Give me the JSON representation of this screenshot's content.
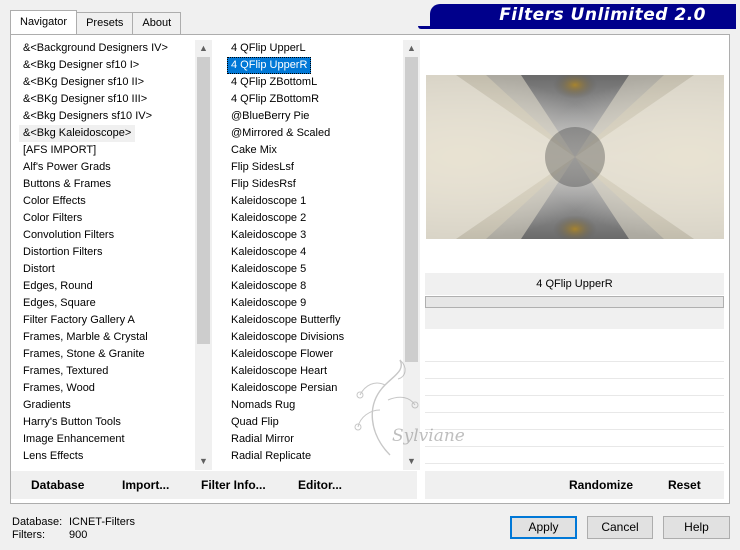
{
  "tabs": [
    "Navigator",
    "Presets",
    "About"
  ],
  "banner_title": "Filters Unlimited 2.0",
  "categories": [
    "&<Background Designers IV>",
    "&<Bkg Designer sf10 I>",
    "&<BKg Designer sf10 II>",
    "&<BKg Designer sf10 III>",
    "&<Bkg Designers sf10 IV>",
    "&<Bkg Kaleidoscope>",
    "[AFS IMPORT]",
    "Alf's Power Grads",
    "Buttons & Frames",
    "Color Effects",
    "Color Filters",
    "Convolution Filters",
    "Distortion Filters",
    "Distort",
    "Edges, Round",
    "Edges, Square",
    "Filter Factory Gallery A",
    "Frames, Marble & Crystal",
    "Frames, Stone & Granite",
    "Frames, Textured",
    "Frames, Wood",
    "Gradients",
    "Harry's Button Tools",
    "Image Enhancement",
    "Lens Effects"
  ],
  "current_category_index": 5,
  "filters": [
    "4 QFlip UpperL",
    "4 QFlip UpperR",
    "4 QFlip ZBottomL",
    "4 QFlip ZBottomR",
    "@BlueBerry Pie",
    "@Mirrored & Scaled",
    "Cake Mix",
    "Flip SidesLsf",
    "Flip SidesRsf",
    "Kaleidoscope 1",
    "Kaleidoscope 2",
    "Kaleidoscope 3",
    "Kaleidoscope 4",
    "Kaleidoscope 5",
    "Kaleidoscope 8",
    "Kaleidoscope 9",
    "Kaleidoscope Butterfly",
    "Kaleidoscope Divisions",
    "Kaleidoscope Flower",
    "Kaleidoscope Heart",
    "Kaleidoscope Persian",
    "Nomads Rug",
    "Quad Flip",
    "Radial Mirror",
    "Radial Replicate"
  ],
  "selected_filter_index": 1,
  "selected_filter_name": "4 QFlip UpperR",
  "left_buttons": {
    "database": "Database",
    "import": "Import...",
    "filter_info": "Filter Info...",
    "editor": "Editor..."
  },
  "right_buttons": {
    "randomize": "Randomize",
    "reset": "Reset"
  },
  "status": {
    "database_label": "Database:",
    "database_value": "ICNET-Filters",
    "filters_label": "Filters:",
    "filters_value": "900"
  },
  "dialog_buttons": {
    "apply": "Apply",
    "cancel": "Cancel",
    "help": "Help"
  },
  "watermark_text": "Sylviane",
  "colors": {
    "banner": "#00008b",
    "selection": "#0078d7",
    "preview_light": "#e6dcc3",
    "preview_dark": "#3c3c3c",
    "preview_gold": "#9a7a30"
  }
}
